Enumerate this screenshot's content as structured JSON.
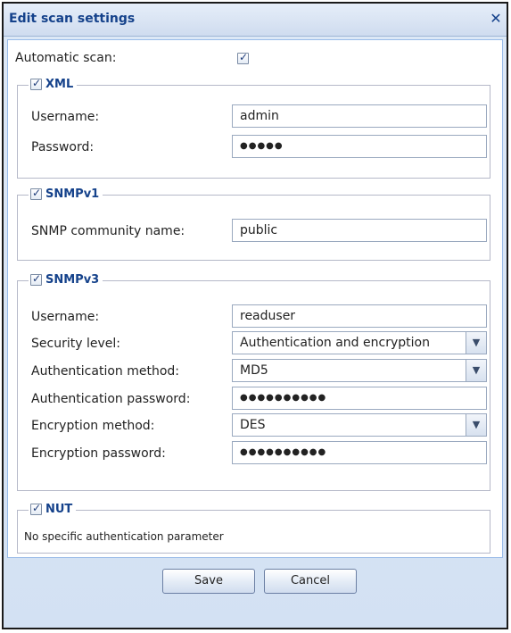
{
  "dialog": {
    "title": "Edit scan settings",
    "close_glyph": "✕"
  },
  "automatic_scan": {
    "label": "Automatic scan:",
    "checked": true
  },
  "xml": {
    "legend": "XML",
    "enabled": true,
    "username_label": "Username:",
    "username_value": "admin",
    "password_label": "Password:",
    "password_value": "●●●●●"
  },
  "snmpv1": {
    "legend": "SNMPv1",
    "enabled": true,
    "community_label": "SNMP community name:",
    "community_value": "public"
  },
  "snmpv3": {
    "legend": "SNMPv3",
    "enabled": true,
    "username_label": "Username:",
    "username_value": "readuser",
    "security_label": "Security level:",
    "security_value": "Authentication and encryption",
    "auth_method_label": "Authentication method:",
    "auth_method_value": "MD5",
    "auth_password_label": "Authentication password:",
    "auth_password_value": "●●●●●●●●●●",
    "enc_method_label": "Encryption method:",
    "enc_method_value": "DES",
    "enc_password_label": "Encryption password:",
    "enc_password_value": "●●●●●●●●●●"
  },
  "nut": {
    "legend": "NUT",
    "enabled": true,
    "note": "No specific authentication parameter"
  },
  "buttons": {
    "save": "Save",
    "cancel": "Cancel"
  },
  "icons": {
    "checkbox": "checkmark-icon",
    "dropdown": "chevron-down-icon",
    "close": "close-icon"
  },
  "colors": {
    "title": "#15428b",
    "frame": "#d3e1f3",
    "border": "#99bbe8"
  }
}
